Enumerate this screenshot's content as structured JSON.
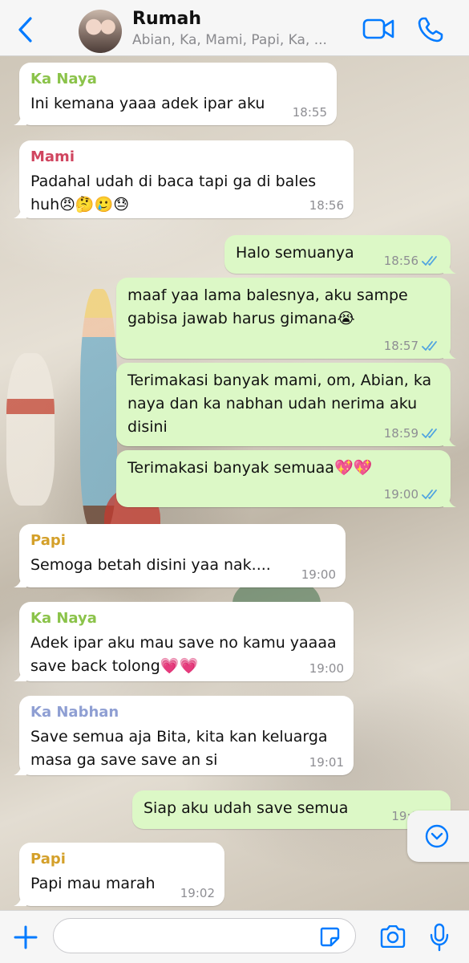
{
  "header": {
    "back_icon": "chevron-left-icon",
    "title": "Rumah",
    "subtitle": "Abian, Ka, Mami, Papi, Ka, ...",
    "video_icon": "video-camera-icon",
    "call_icon": "phone-icon",
    "accent": "#007aff"
  },
  "messages": [
    {
      "dir": "in",
      "sender": "Ka Naya",
      "sender_color": "#8bc34a",
      "text": "Ini kemana yaaa adek ipar aku",
      "time": "18:55"
    },
    {
      "dir": "in",
      "sender": "Mami",
      "sender_color": "#d0455f",
      "text": "Padahal udah di baca tapi ga di bales huh😠🤔🥲😓",
      "time": "18:56"
    },
    {
      "dir": "out",
      "text": "Halo semuanya",
      "time": "18:56"
    },
    {
      "dir": "out",
      "text": "maaf yaa lama balesnya, aku sampe gabisa jawab harus gimana😭",
      "time": "18:57"
    },
    {
      "dir": "out",
      "text": "Terimakasi banyak mami, om, Abian, ka naya dan ka nabhan udah nerima aku disini",
      "time": "18:59"
    },
    {
      "dir": "out",
      "text": "Terimakasi banyak semuaa💖💖",
      "time": "19:00"
    },
    {
      "dir": "in",
      "sender": "Papi",
      "sender_color": "#d4a02a",
      "text": "Semoga betah disini yaa nak....",
      "time": "19:00"
    },
    {
      "dir": "in",
      "sender": "Ka Naya",
      "sender_color": "#8bc34a",
      "text": "Adek ipar aku mau save no kamu yaaaa save back tolong💗💗",
      "time": "19:00"
    },
    {
      "dir": "in",
      "sender": "Ka Nabhan",
      "sender_color": "#8f9fd3",
      "text": "Save semua aja Bita, kita kan keluarga masa ga save save an si",
      "time": "19:01"
    },
    {
      "dir": "out",
      "text": "Siap aku udah save semua",
      "time": "19:0"
    },
    {
      "dir": "in",
      "sender": "Papi",
      "sender_color": "#d4a02a",
      "text": "Papi mau marah",
      "time": "19:02"
    }
  ],
  "scroll_icon": "chevron-down-circle-icon",
  "inputbar": {
    "add_icon": "plus-icon",
    "input_value": "",
    "sticker_icon": "sticker-icon",
    "camera_icon": "camera-icon",
    "mic_icon": "microphone-icon"
  },
  "colors": {
    "incoming_bubble": "#ffffff",
    "outgoing_bubble": "#dcf8c6",
    "read_ticks": "#4fa3e0"
  }
}
